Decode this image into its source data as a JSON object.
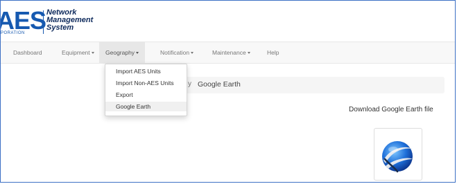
{
  "logo": {
    "abbr": "AES",
    "corp": "PORATION",
    "line1": "Network",
    "line2": "Management",
    "line3": "System"
  },
  "nav": {
    "items": [
      {
        "label": "Dashboard"
      },
      {
        "label": "Equipment"
      },
      {
        "label": "Geography"
      },
      {
        "label": "Notification"
      },
      {
        "label": "Maintenance"
      },
      {
        "label": "Help"
      }
    ],
    "active": "Geography"
  },
  "dropdown": {
    "items": [
      {
        "label": "Import AES Units"
      },
      {
        "label": "Import Non-AES Units"
      },
      {
        "label": "Export"
      },
      {
        "label": "Google Earth"
      }
    ],
    "hovered": "Google Earth"
  },
  "breadcrumb": {
    "partial": "y",
    "separator": "/",
    "current": "Google Earth"
  },
  "main": {
    "download_label": "Download Google Earth file",
    "icon": "google-earth-icon"
  },
  "colors": {
    "brand": "#1659b0",
    "navbar_bg": "#f8f8f8",
    "active_bg": "#e7e7e7"
  }
}
